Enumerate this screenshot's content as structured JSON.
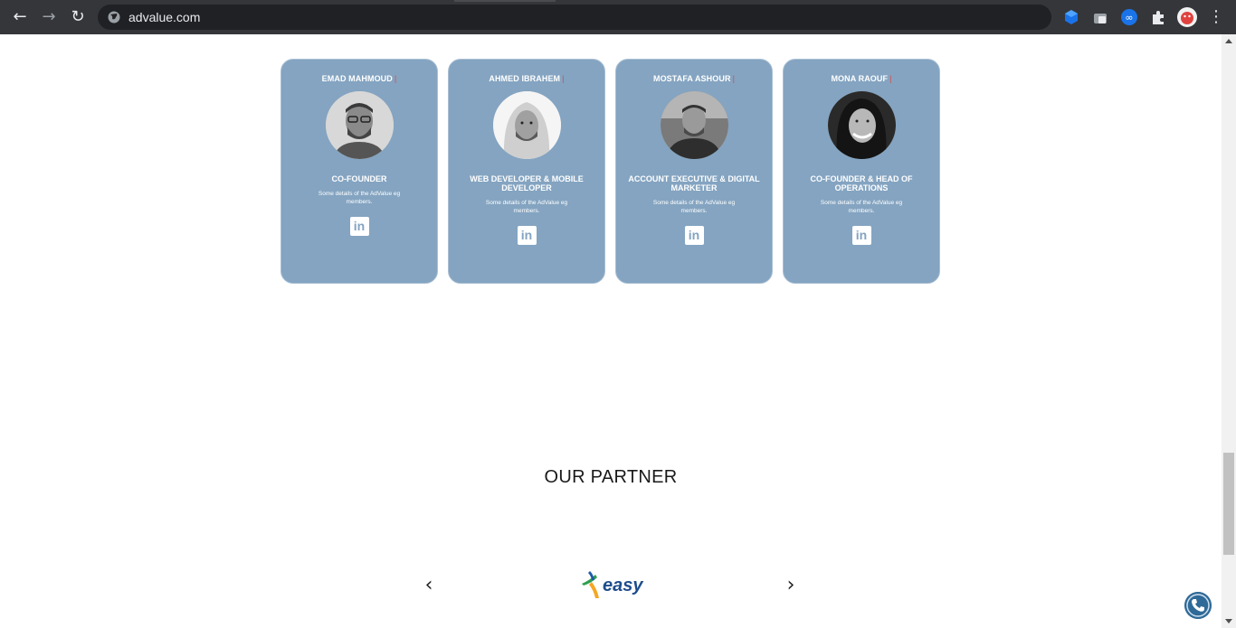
{
  "browser": {
    "url": "advalue.com",
    "extensions": [
      "cube-icon",
      "gift-icon",
      "infinity-icon",
      "puzzle-icon",
      "avatar"
    ]
  },
  "team": [
    {
      "name": "EMAD MAHMOUD",
      "role": "CO-FOUNDER",
      "desc": "Some details of the AdValue eg members."
    },
    {
      "name": "AHMED IBRAHEM",
      "role": "WEB DEVELOPER & MOBILE DEVELOPER",
      "desc": "Some details of the AdValue eg members."
    },
    {
      "name": "MOSTAFA ASHOUR",
      "role": "ACCOUNT EXECUTIVE & DIGITAL MARKETER",
      "desc": "Some details of the AdValue eg members."
    },
    {
      "name": "MONA RAOUF",
      "role": "CO-FOUNDER & HEAD OF OPERATIONS",
      "desc": "Some details of the AdValue eg members."
    }
  ],
  "name_separator": "|",
  "linkedin_label": "in",
  "partner": {
    "title": "OUR PARTNER",
    "logo_text": "easy",
    "prev": "‹",
    "next": "›"
  },
  "colors": {
    "card_bg": "#84a4c1",
    "chrome_bg": "#35363a",
    "phone_button": "#2f6a98"
  }
}
